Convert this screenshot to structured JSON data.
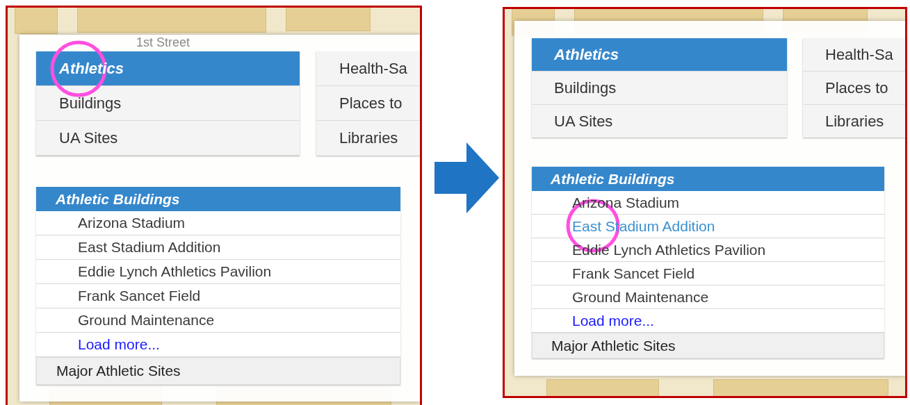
{
  "panels": [
    {
      "map_labels": [
        "1st Street"
      ],
      "categories": [
        [
          {
            "label": "Athletics",
            "selected": true,
            "circled": true
          },
          {
            "label": "Buildings",
            "selected": false,
            "circled": false
          },
          {
            "label": "UA Sites",
            "selected": false,
            "circled": false
          }
        ],
        [
          {
            "label": "Health-Sa",
            "selected": false,
            "circled": false
          },
          {
            "label": "Places to",
            "selected": false,
            "circled": false
          },
          {
            "label": "Libraries",
            "selected": false,
            "circled": false
          }
        ]
      ],
      "sublist": {
        "title": "Athletic Buildings",
        "items": [
          {
            "kind": "item",
            "label": "Arizona Stadium",
            "hovered": false,
            "circled": false
          },
          {
            "kind": "item",
            "label": "East Stadium Addition",
            "hovered": false,
            "circled": false
          },
          {
            "kind": "item",
            "label": "Eddie Lynch Athletics Pavilion",
            "hovered": false,
            "circled": false
          },
          {
            "kind": "item",
            "label": "Frank Sancet Field",
            "hovered": false,
            "circled": false
          },
          {
            "kind": "item",
            "label": "Ground Maintenance",
            "hovered": false,
            "circled": false
          },
          {
            "kind": "link",
            "label": "Load more...",
            "hovered": false,
            "circled": false
          }
        ],
        "footer": "Major Athletic Sites"
      }
    },
    {
      "categories": [
        [
          {
            "label": "Athletics",
            "selected": true,
            "circled": false
          },
          {
            "label": "Buildings",
            "selected": false,
            "circled": false
          },
          {
            "label": "UA Sites",
            "selected": false,
            "circled": false
          }
        ],
        [
          {
            "label": "Health-Sa",
            "selected": false,
            "circled": false
          },
          {
            "label": "Places to",
            "selected": false,
            "circled": false
          },
          {
            "label": "Libraries",
            "selected": false,
            "circled": false
          }
        ]
      ],
      "sublist": {
        "title": "Athletic Buildings",
        "items": [
          {
            "kind": "item",
            "label": "Arizona Stadium",
            "hovered": false,
            "circled": false
          },
          {
            "kind": "item",
            "label": "East Stadium Addition",
            "hovered": true,
            "circled": true
          },
          {
            "kind": "item",
            "label": "Eddie Lynch Athletics Pavilion",
            "hovered": false,
            "circled": false
          },
          {
            "kind": "item",
            "label": "Frank Sancet Field",
            "hovered": false,
            "circled": false
          },
          {
            "kind": "item",
            "label": "Ground Maintenance",
            "hovered": false,
            "circled": false
          },
          {
            "kind": "link",
            "label": "Load more...",
            "hovered": false,
            "circled": false
          }
        ],
        "footer": "Major Athletic Sites"
      }
    }
  ]
}
